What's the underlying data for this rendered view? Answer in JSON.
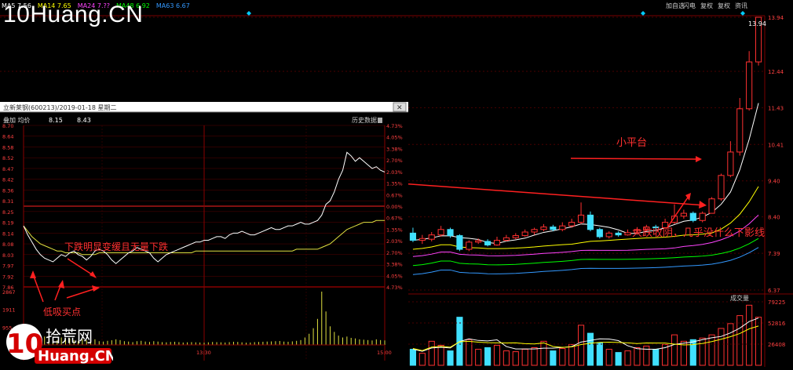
{
  "watermark": "10Huang.CN",
  "logo": {
    "cn": "拾荒网",
    "en": "Huang.CN",
    "num": "10"
  },
  "main": {
    "ma_legend": [
      {
        "text": "MA5  7.56",
        "color": "#ffffff"
      },
      {
        "text": "MA14  7.65",
        "color": "#ffff00"
      },
      {
        "text": "MA24  7.??",
        "color": "#ff44ff"
      },
      {
        "text": "MA48  6.92",
        "color": "#00ff00"
      },
      {
        "text": "MA63  6.67",
        "color": "#3399ff"
      }
    ],
    "toolbar": [
      "加自选",
      "闪电",
      "复权",
      "复权",
      "资讯"
    ],
    "y_ticks": [
      "13.94",
      "12.44",
      "11.43",
      "10.41",
      "9.40",
      "8.40",
      "7.39",
      "6.37"
    ],
    "top_value": "13.94",
    "annotations": {
      "platform": "小平台",
      "bottom": "大跌收阴，几乎没什么下影线"
    },
    "vol_label": "成交量",
    "vol_ticks": [
      "79225",
      "52816",
      "26408"
    ],
    "ma_color_map": {
      "ma5": "#ffffff",
      "ma14": "#ffff00",
      "ma24": "#ff44ff",
      "ma48": "#00ff00",
      "ma63": "#3399ff"
    }
  },
  "chart_data": [
    {
      "type": "candlestick",
      "candles": [
        [
          7.95,
          7.75,
          8.1,
          7.7
        ],
        [
          7.75,
          7.8,
          7.9,
          7.65
        ],
        [
          7.78,
          7.9,
          7.98,
          7.72
        ],
        [
          7.9,
          8.05,
          8.15,
          7.85
        ],
        [
          8.05,
          7.88,
          8.1,
          7.82
        ],
        [
          7.88,
          7.5,
          7.92,
          7.45
        ],
        [
          7.5,
          7.7,
          7.75,
          7.45
        ],
        [
          7.7,
          7.74,
          7.8,
          7.65
        ],
        [
          7.72,
          7.62,
          7.78,
          7.58
        ],
        [
          7.62,
          7.75,
          7.85,
          7.6
        ],
        [
          7.75,
          7.82,
          7.9,
          7.72
        ],
        [
          7.82,
          7.88,
          7.95,
          7.78
        ],
        [
          7.88,
          7.98,
          8.05,
          7.85
        ],
        [
          7.98,
          8.05,
          8.1,
          7.9
        ],
        [
          8.05,
          8.12,
          8.2,
          8.0
        ],
        [
          8.12,
          8.05,
          8.18,
          8.0
        ],
        [
          8.05,
          8.15,
          8.25,
          8.0
        ],
        [
          8.15,
          8.25,
          8.35,
          8.1
        ],
        [
          8.25,
          8.45,
          8.8,
          8.2
        ],
        [
          8.45,
          8.05,
          8.55,
          8.0
        ],
        [
          8.05,
          7.85,
          8.1,
          7.8
        ],
        [
          7.85,
          7.95,
          8.0,
          7.8
        ],
        [
          7.95,
          7.9,
          8.0,
          7.85
        ],
        [
          7.9,
          7.96,
          8.05,
          7.88
        ],
        [
          7.96,
          8.05,
          8.1,
          7.9
        ],
        [
          8.05,
          8.12,
          8.18,
          8.0
        ],
        [
          8.12,
          8.1,
          8.18,
          8.05
        ],
        [
          8.1,
          8.25,
          8.35,
          8.1
        ],
        [
          8.25,
          8.42,
          8.75,
          8.2
        ],
        [
          8.42,
          8.5,
          8.6,
          8.35
        ],
        [
          8.5,
          8.3,
          8.55,
          8.25
        ],
        [
          8.3,
          8.5,
          8.55,
          8.25
        ],
        [
          8.5,
          8.9,
          8.95,
          8.5
        ],
        [
          8.9,
          9.55,
          9.6,
          8.85
        ],
        [
          9.55,
          10.2,
          10.5,
          9.5
        ],
        [
          10.2,
          11.4,
          11.7,
          10.1
        ],
        [
          11.4,
          12.7,
          13.0,
          11.35
        ],
        [
          12.7,
          13.94,
          13.94,
          12.6
        ]
      ],
      "y_range": [
        6.37,
        13.94
      ],
      "volume": [
        20000,
        15000,
        30000,
        25000,
        18000,
        60000,
        32000,
        20000,
        22000,
        25000,
        18000,
        17000,
        20000,
        22000,
        30000,
        18000,
        21000,
        26000,
        50000,
        40000,
        28000,
        20000,
        16000,
        18000,
        22000,
        24000,
        20000,
        26000,
        38000,
        30000,
        32000,
        34000,
        38000,
        46000,
        52000,
        62000,
        75000,
        60000
      ],
      "vol_range": [
        0,
        79225
      ]
    },
    {
      "type": "line",
      "title": "立新莱钢(600213)/2019-01-18 星期二",
      "header_label": "叠加 均价",
      "header_values": [
        "8.15",
        "8.43"
      ],
      "history_btn": "历史数据",
      "prev_close": 8.25,
      "y_range": [
        7.8,
        8.7
      ],
      "price_ticks": [
        "8.70",
        "8.64",
        "8.58",
        "8.52",
        "8.47",
        "8.42",
        "8.36",
        "8.31",
        "8.25",
        "8.19",
        "8.14",
        "8.08",
        "8.03",
        "7.97",
        "7.92",
        "7.86"
      ],
      "pct_ticks": [
        "4.73%",
        "4.05%",
        "3.38%",
        "2.70%",
        "2.03%",
        "1.35%",
        "0.67%",
        "0.00%",
        "0.67%",
        "1.35%",
        "2.03%",
        "2.70%",
        "3.38%",
        "4.05%",
        "4.73%"
      ],
      "vol_ticks": [
        "2867",
        "1911",
        "955"
      ],
      "time_labels": [
        "9:30",
        "13:30",
        "15:00"
      ],
      "annotations": {
        "drop": "下跌明显变缓且无量下跌",
        "low": "低吸买点"
      },
      "price": [
        8.14,
        8.09,
        8.05,
        8.01,
        7.98,
        7.96,
        7.95,
        7.94,
        7.96,
        7.98,
        7.97,
        7.99,
        8.0,
        7.98,
        7.97,
        7.95,
        7.97,
        8.0,
        8.01,
        8.0,
        7.98,
        7.95,
        7.93,
        7.95,
        7.97,
        7.99,
        8.0,
        8.02,
        8.01,
        8.0,
        7.99,
        7.96,
        7.94,
        7.96,
        7.98,
        7.99,
        8.0,
        8.01,
        8.02,
        8.03,
        8.04,
        8.05,
        8.05,
        8.06,
        8.06,
        8.07,
        8.08,
        8.08,
        8.07,
        8.09,
        8.1,
        8.1,
        8.11,
        8.1,
        8.09,
        8.09,
        8.1,
        8.11,
        8.12,
        8.13,
        8.12,
        8.12,
        8.13,
        8.14,
        8.14,
        8.15,
        8.16,
        8.15,
        8.15,
        8.16,
        8.17,
        8.2,
        8.26,
        8.28,
        8.33,
        8.4,
        8.45,
        8.55,
        8.53,
        8.5,
        8.52,
        8.5,
        8.48,
        8.46,
        8.47,
        8.45,
        8.44
      ],
      "avg": [
        8.14,
        8.11,
        8.08,
        8.06,
        8.04,
        8.03,
        8.02,
        8.01,
        8.0,
        8.0,
        7.99,
        7.99,
        7.99,
        7.99,
        7.98,
        7.98,
        7.98,
        7.98,
        7.99,
        7.99,
        7.99,
        7.99,
        7.99,
        7.99,
        7.99,
        7.99,
        7.99,
        7.99,
        7.99,
        7.99,
        7.99,
        7.99,
        7.99,
        7.99,
        7.99,
        7.99,
        7.99,
        7.99,
        7.99,
        7.99,
        7.99,
        8.0,
        8.0,
        8.0,
        8.0,
        8.0,
        8.0,
        8.0,
        8.0,
        8.0,
        8.0,
        8.0,
        8.0,
        8.0,
        8.0,
        8.0,
        8.0,
        8.0,
        8.0,
        8.0,
        8.0,
        8.0,
        8.0,
        8.0,
        8.0,
        8.01,
        8.01,
        8.01,
        8.01,
        8.01,
        8.01,
        8.02,
        8.03,
        8.04,
        8.06,
        8.08,
        8.1,
        8.12,
        8.13,
        8.14,
        8.15,
        8.16,
        8.16,
        8.16,
        8.17,
        8.17,
        8.17
      ],
      "volume": [
        800,
        600,
        500,
        400,
        350,
        450,
        500,
        300,
        250,
        400,
        300,
        350,
        250,
        200,
        300,
        250,
        280,
        300,
        200,
        180,
        220,
        250,
        300,
        260,
        200,
        180,
        150,
        200,
        220,
        180,
        160,
        200,
        180,
        150,
        140,
        160,
        170,
        150,
        130,
        140,
        150,
        140,
        130,
        120,
        140,
        160,
        150,
        140,
        130,
        150,
        170,
        160,
        140,
        120,
        130,
        150,
        160,
        170,
        180,
        190,
        200,
        210,
        180,
        170,
        190,
        220,
        260,
        400,
        600,
        900,
        1400,
        2867,
        1800,
        1000,
        700,
        500,
        400,
        450,
        380,
        350,
        300,
        280,
        260,
        240,
        300,
        260,
        240
      ]
    }
  ]
}
